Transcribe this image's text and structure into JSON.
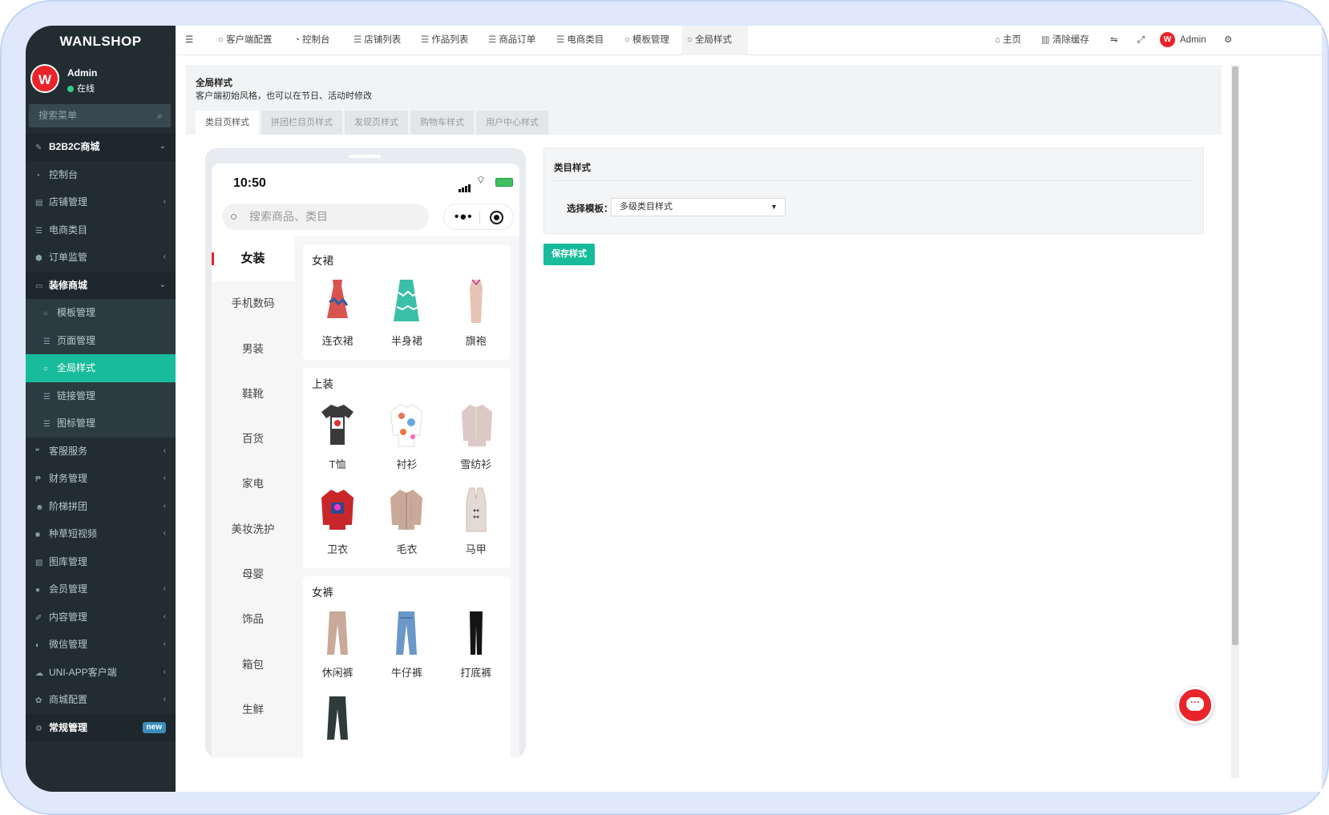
{
  "sidebar": {
    "logo": "WANLSHOP",
    "user_name": "Admin",
    "user_status": "在线",
    "avatar_letter": "W",
    "search_placeholder": "搜索菜单",
    "menu": [
      {
        "label": "B2B2C商城",
        "icon": "wand-icon",
        "type": "head",
        "arrow": "⌄"
      },
      {
        "label": "控制台",
        "icon": "dashboard-icon"
      },
      {
        "label": "店铺管理",
        "icon": "store-icon",
        "arrow": "‹"
      },
      {
        "label": "电商类目",
        "icon": "list-icon"
      },
      {
        "label": "订单监管",
        "icon": "cube-icon",
        "arrow": "‹"
      },
      {
        "label": "装修商城",
        "icon": "desktop-icon",
        "type": "head",
        "arrow": "⌄"
      },
      {
        "label": "模板管理",
        "icon": "circle-icon",
        "type": "sub"
      },
      {
        "label": "页面管理",
        "icon": "list-icon",
        "type": "sub"
      },
      {
        "label": "全局样式",
        "icon": "circle-icon",
        "type": "sub",
        "active": true
      },
      {
        "label": "链接管理",
        "icon": "list-icon",
        "type": "sub"
      },
      {
        "label": "图标管理",
        "icon": "list-icon",
        "type": "sub"
      },
      {
        "label": "客服服务",
        "icon": "comments-icon",
        "arrow": "‹"
      },
      {
        "label": "财务管理",
        "icon": "paypal-icon",
        "arrow": "‹"
      },
      {
        "label": "阶梯拼团",
        "icon": "users-icon",
        "arrow": "‹"
      },
      {
        "label": "种草短视频",
        "icon": "video-icon",
        "arrow": "‹"
      },
      {
        "label": "图库管理",
        "icon": "image-icon"
      },
      {
        "label": "会员管理",
        "icon": "user-icon",
        "arrow": "‹"
      },
      {
        "label": "内容管理",
        "icon": "edit-icon",
        "arrow": "‹"
      },
      {
        "label": "微信管理",
        "icon": "wechat-icon",
        "arrow": "‹"
      },
      {
        "label": "UNI-APP客户端",
        "icon": "cloud-icon",
        "arrow": "‹"
      },
      {
        "label": "商城配置",
        "icon": "gear-icon",
        "arrow": "‹"
      },
      {
        "label": "常规管理",
        "icon": "gears-icon",
        "type": "head",
        "badge": "new"
      }
    ]
  },
  "topbar": {
    "menu_icon": "hamburger-icon",
    "tabs": [
      {
        "label": "客户端配置",
        "icon": "circle-icon"
      },
      {
        "label": "控制台",
        "icon": "dashboard-icon"
      },
      {
        "label": "店铺列表",
        "icon": "list-icon"
      },
      {
        "label": "作品列表",
        "icon": "list-icon"
      },
      {
        "label": "商品订单",
        "icon": "list-icon"
      },
      {
        "label": "电商类目",
        "icon": "list-icon"
      },
      {
        "label": "模板管理",
        "icon": "circle-icon"
      },
      {
        "label": "全局样式",
        "icon": "circle-icon",
        "current": true
      }
    ],
    "home": "主页",
    "clear_cache": "清除缓存",
    "admin": "Admin"
  },
  "page": {
    "title": "全局样式",
    "description": "客户端初始风格，也可以在节日、活动时修改",
    "tabs": [
      "类目页样式",
      "拼团栏目页样式",
      "发现页样式",
      "购物车样式",
      "用户中心样式"
    ],
    "current_tab": 0
  },
  "phone": {
    "time": "10:50",
    "search_placeholder": "搜索商品、类目",
    "categories": [
      "女装",
      "手机数码",
      "男装",
      "鞋靴",
      "百货",
      "家电",
      "美妆洗护",
      "母婴",
      "饰品",
      "箱包",
      "生鲜"
    ],
    "current_category": 0,
    "groups": [
      {
        "title": "女裙",
        "items": [
          {
            "name": "连衣裙",
            "icon": "dress-icon",
            "color": "#d9534f"
          },
          {
            "name": "半身裙",
            "icon": "skirt-icon",
            "color": "#3cbfa8"
          },
          {
            "name": "旗袍",
            "icon": "qipao-icon",
            "color": "#e7c3b6"
          }
        ]
      },
      {
        "title": "上装",
        "items": [
          {
            "name": "T恤",
            "icon": "tshirt-icon",
            "color": "#3a3a3a"
          },
          {
            "name": "衬衫",
            "icon": "shirt-icon",
            "color": "#e8745c"
          },
          {
            "name": "雪纺衫",
            "icon": "blouse-icon",
            "color": "#dcc9c7"
          },
          {
            "name": "卫衣",
            "icon": "hoodie-icon",
            "color": "#c8262a"
          },
          {
            "name": "毛衣",
            "icon": "sweater-icon",
            "color": "#c9aa98"
          },
          {
            "name": "马甲",
            "icon": "vest-icon",
            "color": "#e5d9d3"
          }
        ]
      },
      {
        "title": "女裤",
        "items": [
          {
            "name": "休闲裤",
            "icon": "pants-icon",
            "color": "#c9a99a"
          },
          {
            "name": "牛仔裤",
            "icon": "jeans-icon",
            "color": "#6a98c9"
          },
          {
            "name": "打底裤",
            "icon": "leggings-icon",
            "color": "#151515"
          },
          {
            "name": "",
            "icon": "pants-icon",
            "color": "#2f3a3a"
          }
        ]
      }
    ]
  },
  "settings": {
    "heading": "类目样式",
    "template_label": "选择模板：",
    "template_value": "多级类目样式",
    "save_label": "保存样式"
  },
  "colors": {
    "accent": "#18bc9c",
    "sidebar": "#222d32",
    "brand_red": "#e8242a"
  }
}
